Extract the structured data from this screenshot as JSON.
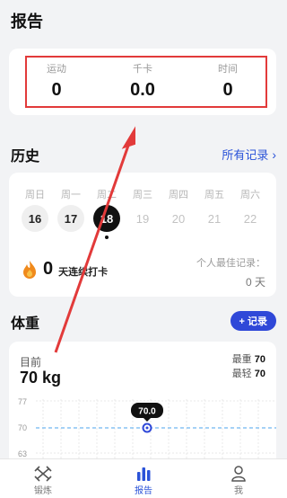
{
  "page": {
    "title": "报告"
  },
  "stats": [
    {
      "label": "运动",
      "value": "0"
    },
    {
      "label": "千卡",
      "value": "0.0"
    },
    {
      "label": "时间",
      "value": "0"
    }
  ],
  "history": {
    "title": "历史",
    "all_records": "所有记录",
    "weekdays": [
      "周日",
      "周一",
      "周二",
      "周三",
      "周四",
      "周五",
      "周六"
    ],
    "dates": [
      "16",
      "17",
      "18",
      "19",
      "20",
      "21",
      "22"
    ],
    "today_index": 2,
    "streak_value": "0",
    "streak_label": "天连续打卡",
    "best_label": "个人最佳记录：",
    "best_value": "0 天"
  },
  "weight": {
    "title": "体重",
    "add_label": "+ 记录",
    "current_label": "目前",
    "current_value": "70 kg",
    "max_label": "最重",
    "max_value": "70",
    "min_label": "最轻",
    "min_value": "70",
    "y_ticks": [
      "77",
      "70",
      "63"
    ],
    "marker_value": "70.0"
  },
  "tabs": [
    {
      "label": "锻炼",
      "icon": "dumbbell-icon"
    },
    {
      "label": "报告",
      "icon": "bar-chart-icon",
      "active": true
    },
    {
      "label": "我",
      "icon": "user-icon"
    }
  ],
  "colors": {
    "accent": "#2b53d8",
    "highlight": "#e23a3a"
  }
}
